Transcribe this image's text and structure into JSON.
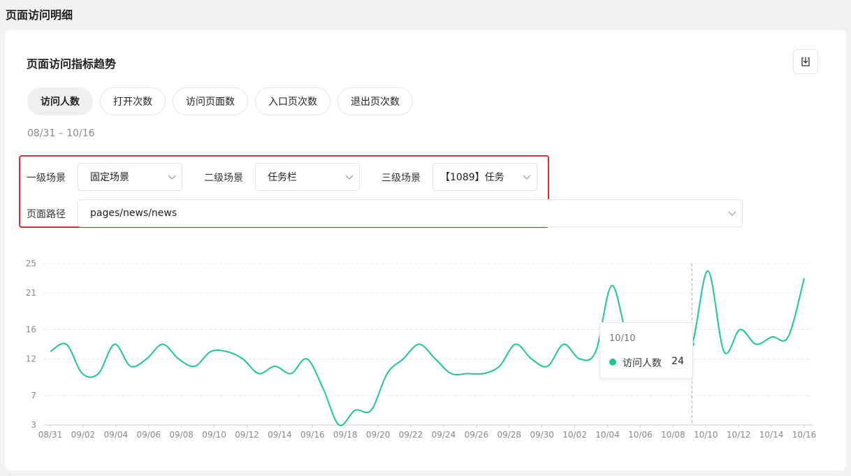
{
  "page": {
    "title": "页面访问明细"
  },
  "card": {
    "title": "页面访问指标趋势",
    "download_icon": "download-icon"
  },
  "tabs": [
    {
      "label": "访问人数",
      "active": true
    },
    {
      "label": "打开次数",
      "active": false
    },
    {
      "label": "访问页面数",
      "active": false
    },
    {
      "label": "入口页次数",
      "active": false
    },
    {
      "label": "退出页次数",
      "active": false
    }
  ],
  "date_range": "08/31 – 10/16",
  "filters": {
    "level1": {
      "label": "一级场景",
      "value": "固定场景"
    },
    "level2": {
      "label": "二级场景",
      "value": "任务栏"
    },
    "level3": {
      "label": "三级场景",
      "value": "【1089】任务"
    },
    "path": {
      "label": "页面路径",
      "value": "pages/news/news"
    }
  },
  "tooltip": {
    "date": "10/10",
    "series": "访问人数",
    "value": "24"
  },
  "colors": {
    "line": "#1cc98a",
    "highlight_border": "#e02c2c"
  },
  "chart_data": {
    "type": "line",
    "y_ticks": [
      "3",
      "7",
      "12",
      "16",
      "21",
      "25"
    ],
    "ylim": [
      3,
      25
    ],
    "x_tick_labels": [
      "08/31",
      "09/02",
      "09/04",
      "09/06",
      "09/08",
      "09/10",
      "09/12",
      "09/14",
      "09/16",
      "09/18",
      "09/20",
      "09/22",
      "09/24",
      "09/26",
      "09/28",
      "09/30",
      "10/02",
      "10/04",
      "10/06",
      "10/08",
      "10/10",
      "10/12",
      "10/14",
      "10/16"
    ],
    "x": [
      "08/31",
      "09/01",
      "09/02",
      "09/03",
      "09/04",
      "09/05",
      "09/06",
      "09/07",
      "09/08",
      "09/09",
      "09/10",
      "09/11",
      "09/12",
      "09/13",
      "09/14",
      "09/15",
      "09/16",
      "09/17",
      "09/18",
      "09/19",
      "09/20",
      "09/21",
      "09/22",
      "09/23",
      "09/24",
      "09/25",
      "09/26",
      "09/27",
      "09/28",
      "09/29",
      "09/30",
      "10/01",
      "10/02",
      "10/03",
      "10/04",
      "10/05",
      "10/06",
      "10/07",
      "10/08",
      "10/09",
      "10/10",
      "10/11",
      "10/12",
      "10/13",
      "10/14",
      "10/15",
      "10/16"
    ],
    "series": [
      {
        "name": "访问人数",
        "values": [
          13,
          14,
          10,
          10,
          14,
          11,
          12,
          14,
          12,
          11,
          13,
          13,
          12,
          10,
          11,
          10,
          12,
          8,
          3,
          5,
          5,
          10,
          12,
          14,
          12,
          10,
          10,
          10,
          11,
          14,
          12,
          11,
          14,
          12,
          13,
          22,
          15,
          15,
          13,
          14,
          14,
          24,
          13,
          16,
          14,
          15,
          15,
          23
        ]
      }
    ],
    "highlight_index": 40,
    "grid": true
  }
}
